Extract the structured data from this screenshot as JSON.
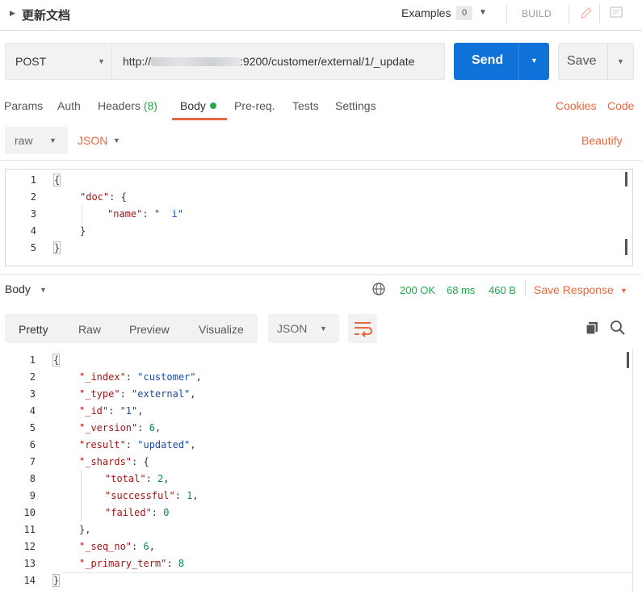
{
  "request": {
    "title": "更新文档",
    "examples_label": "Examples",
    "examples_count": "0",
    "build_label": "BUILD",
    "method": "POST",
    "url_prefix": "http://",
    "url_suffix": ":9200/customer/external/1/_update",
    "send_label": "Send",
    "save_label": "Save"
  },
  "request_tabs": {
    "params": "Params",
    "auth": "Auth",
    "headers": "Headers",
    "headers_count": "(8)",
    "body": "Body",
    "prereq": "Pre-req.",
    "tests": "Tests",
    "settings": "Settings",
    "cookies": "Cookies",
    "code": "Code"
  },
  "body_bar": {
    "mode": "raw",
    "format": "JSON",
    "beautify": "Beautify"
  },
  "request_body": {
    "line_numbers": [
      "1",
      "2",
      "3",
      "4",
      "5"
    ],
    "l1": "{",
    "l2_key": "\"doc\"",
    "l2_rest": ": {",
    "l3_key": "\"name\"",
    "l3_colon": ": ",
    "l3_value": "\"  i\"",
    "l4": "}",
    "l5": "}"
  },
  "response": {
    "body_label": "Body",
    "status": "200 OK",
    "time": "68 ms",
    "size": "460 B",
    "save_response": "Save Response",
    "view_tabs": {
      "pretty": "Pretty",
      "raw": "Raw",
      "preview": "Preview",
      "visualize": "Visualize"
    },
    "format": "JSON",
    "line_numbers": [
      "1",
      "2",
      "3",
      "4",
      "5",
      "6",
      "7",
      "8",
      "9",
      "10",
      "11",
      "12",
      "13",
      "14"
    ],
    "lines": {
      "l1": "{",
      "l2_key": "\"_index\"",
      "l2_val": "\"customer\"",
      "l3_key": "\"_type\"",
      "l3_val": "\"external\"",
      "l4_key": "\"_id\"",
      "l4_val": "\"1\"",
      "l5_key": "\"_version\"",
      "l5_val": "6",
      "l6_key": "\"result\"",
      "l6_val": "\"updated\"",
      "l7_key": "\"_shards\"",
      "l7_rest": ": {",
      "l8_key": "\"total\"",
      "l8_val": "2",
      "l9_key": "\"successful\"",
      "l9_val": "1",
      "l10_key": "\"failed\"",
      "l10_val": "0",
      "l11": "},",
      "l12_key": "\"_seq_no\"",
      "l12_val": "6",
      "l13_key": "\"_primary_term\"",
      "l13_val": "8",
      "l14": "}"
    }
  },
  "colors": {
    "send_blue": "#0e72d9",
    "accent_orange": "#e8673c",
    "success_green": "#22a94f",
    "json_key": "#a31515",
    "json_string": "#1a4aa8",
    "json_number": "#098658"
  },
  "icons": [
    "caret-right-icon",
    "pencil-icon",
    "comment-icon",
    "globe-icon",
    "wrap-lines-icon",
    "copy-icon",
    "search-icon"
  ]
}
